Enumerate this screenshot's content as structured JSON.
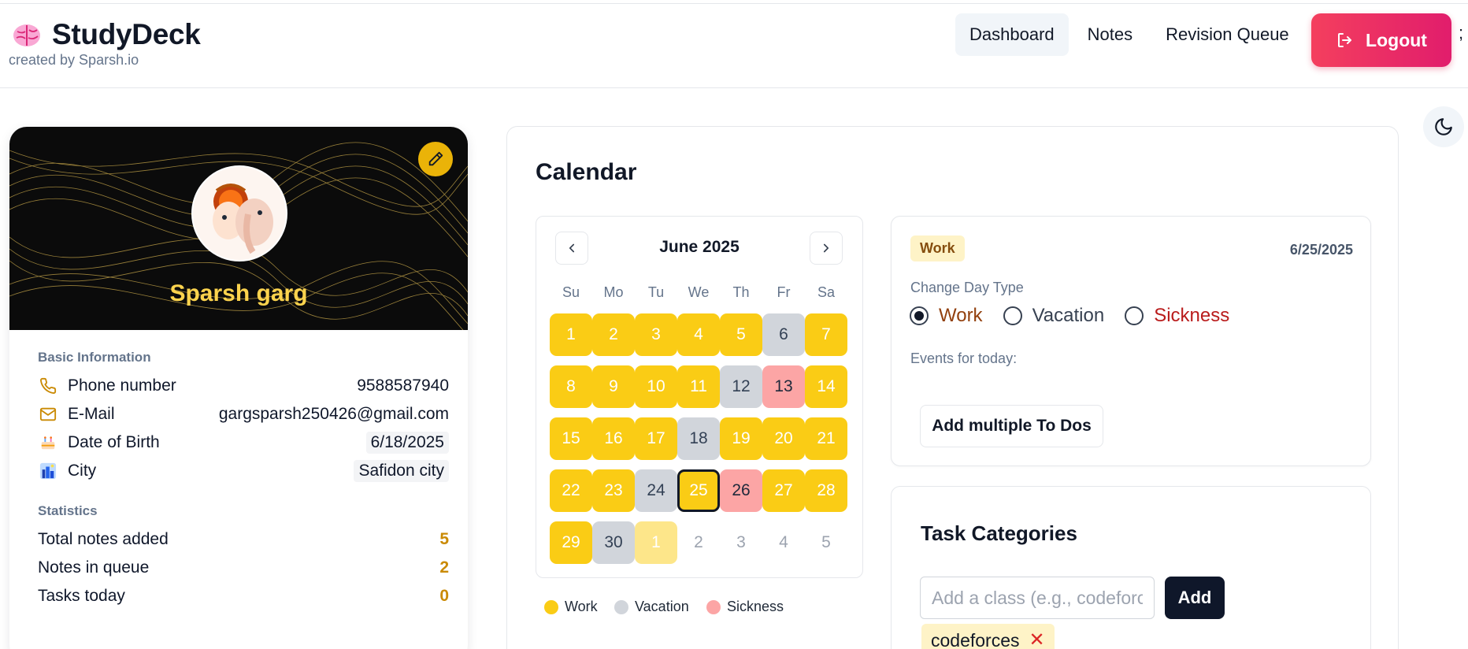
{
  "app": {
    "title": "StudyDeck",
    "subtitle": "created by Sparsh.io",
    "icon": "brain-icon"
  },
  "nav": {
    "items": [
      {
        "label": "Dashboard",
        "active": true
      },
      {
        "label": "Notes",
        "active": false
      },
      {
        "label": "Revision Queue",
        "active": false
      }
    ],
    "logout_label": "Logout",
    "stray_text": ";"
  },
  "theme_toggle": {
    "icon": "moon-icon"
  },
  "profile": {
    "name": "Sparsh garg",
    "basic_title": "Basic Information",
    "info": [
      {
        "label": "Phone number",
        "value": "9588587940",
        "icon": "phone-icon"
      },
      {
        "label": "E-Mail",
        "value": "gargsparsh250426@gmail.com",
        "icon": "mail-icon"
      },
      {
        "label": "Date of Birth",
        "value": "6/18/2025",
        "icon": "cake-icon"
      },
      {
        "label": "City",
        "value": "Safidon city",
        "icon": "cityscape-icon"
      }
    ],
    "stats_title": "Statistics",
    "stats": [
      {
        "label": "Total notes added",
        "value": "5"
      },
      {
        "label": "Notes in queue",
        "value": "2"
      },
      {
        "label": "Tasks today",
        "value": "0"
      }
    ]
  },
  "calendar": {
    "title": "Calendar",
    "month_label": "June 2025",
    "weekdays": [
      "Su",
      "Mo",
      "Tu",
      "We",
      "Th",
      "Fr",
      "Sa"
    ],
    "days": [
      {
        "label": "1",
        "type": "work"
      },
      {
        "label": "2",
        "type": "work"
      },
      {
        "label": "3",
        "type": "work"
      },
      {
        "label": "4",
        "type": "work"
      },
      {
        "label": "5",
        "type": "work"
      },
      {
        "label": "6",
        "type": "vacation"
      },
      {
        "label": "7",
        "type": "work"
      },
      {
        "label": "8",
        "type": "work"
      },
      {
        "label": "9",
        "type": "work"
      },
      {
        "label": "10",
        "type": "work"
      },
      {
        "label": "11",
        "type": "work"
      },
      {
        "label": "12",
        "type": "vacation"
      },
      {
        "label": "13",
        "type": "sickness"
      },
      {
        "label": "14",
        "type": "work"
      },
      {
        "label": "15",
        "type": "work"
      },
      {
        "label": "16",
        "type": "work"
      },
      {
        "label": "17",
        "type": "work"
      },
      {
        "label": "18",
        "type": "vacation"
      },
      {
        "label": "19",
        "type": "work"
      },
      {
        "label": "20",
        "type": "work"
      },
      {
        "label": "21",
        "type": "work"
      },
      {
        "label": "22",
        "type": "work"
      },
      {
        "label": "23",
        "type": "work"
      },
      {
        "label": "24",
        "type": "vacation"
      },
      {
        "label": "25",
        "type": "work",
        "selected": true
      },
      {
        "label": "26",
        "type": "sickness"
      },
      {
        "label": "27",
        "type": "work"
      },
      {
        "label": "28",
        "type": "work"
      },
      {
        "label": "29",
        "type": "work"
      },
      {
        "label": "30",
        "type": "vacation"
      },
      {
        "label": "1",
        "type": "next-work"
      },
      {
        "label": "2",
        "type": "muted"
      },
      {
        "label": "3",
        "type": "muted"
      },
      {
        "label": "4",
        "type": "muted"
      },
      {
        "label": "5",
        "type": "muted"
      }
    ],
    "legend": [
      {
        "label": "Work",
        "color": "#facc15"
      },
      {
        "label": "Vacation",
        "color": "#d1d5db"
      },
      {
        "label": "Sickness",
        "color": "#fca5a5"
      }
    ]
  },
  "day_detail": {
    "badge": "Work",
    "date": "6/25/2025",
    "change_label": "Change Day Type",
    "options": [
      {
        "label": "Work",
        "color": "#92400e",
        "checked": true
      },
      {
        "label": "Vacation",
        "color": "#374151",
        "checked": false
      },
      {
        "label": "Sickness",
        "color": "#b91c1c",
        "checked": false
      }
    ],
    "events_label": "Events for today:",
    "multi_todo_label": "Add multiple To Dos"
  },
  "categories": {
    "title": "Task Categories",
    "input_placeholder": "Add a class (e.g., codeforces)",
    "add_label": "Add",
    "tags": [
      "codeforces"
    ]
  },
  "colors": {
    "work": "#facc15",
    "vacation": "#d1d5db",
    "sickness": "#fca5a5",
    "logout_start": "#f43f5e",
    "logout_end": "#e11d6c",
    "stat_value": "#ca8a04"
  }
}
